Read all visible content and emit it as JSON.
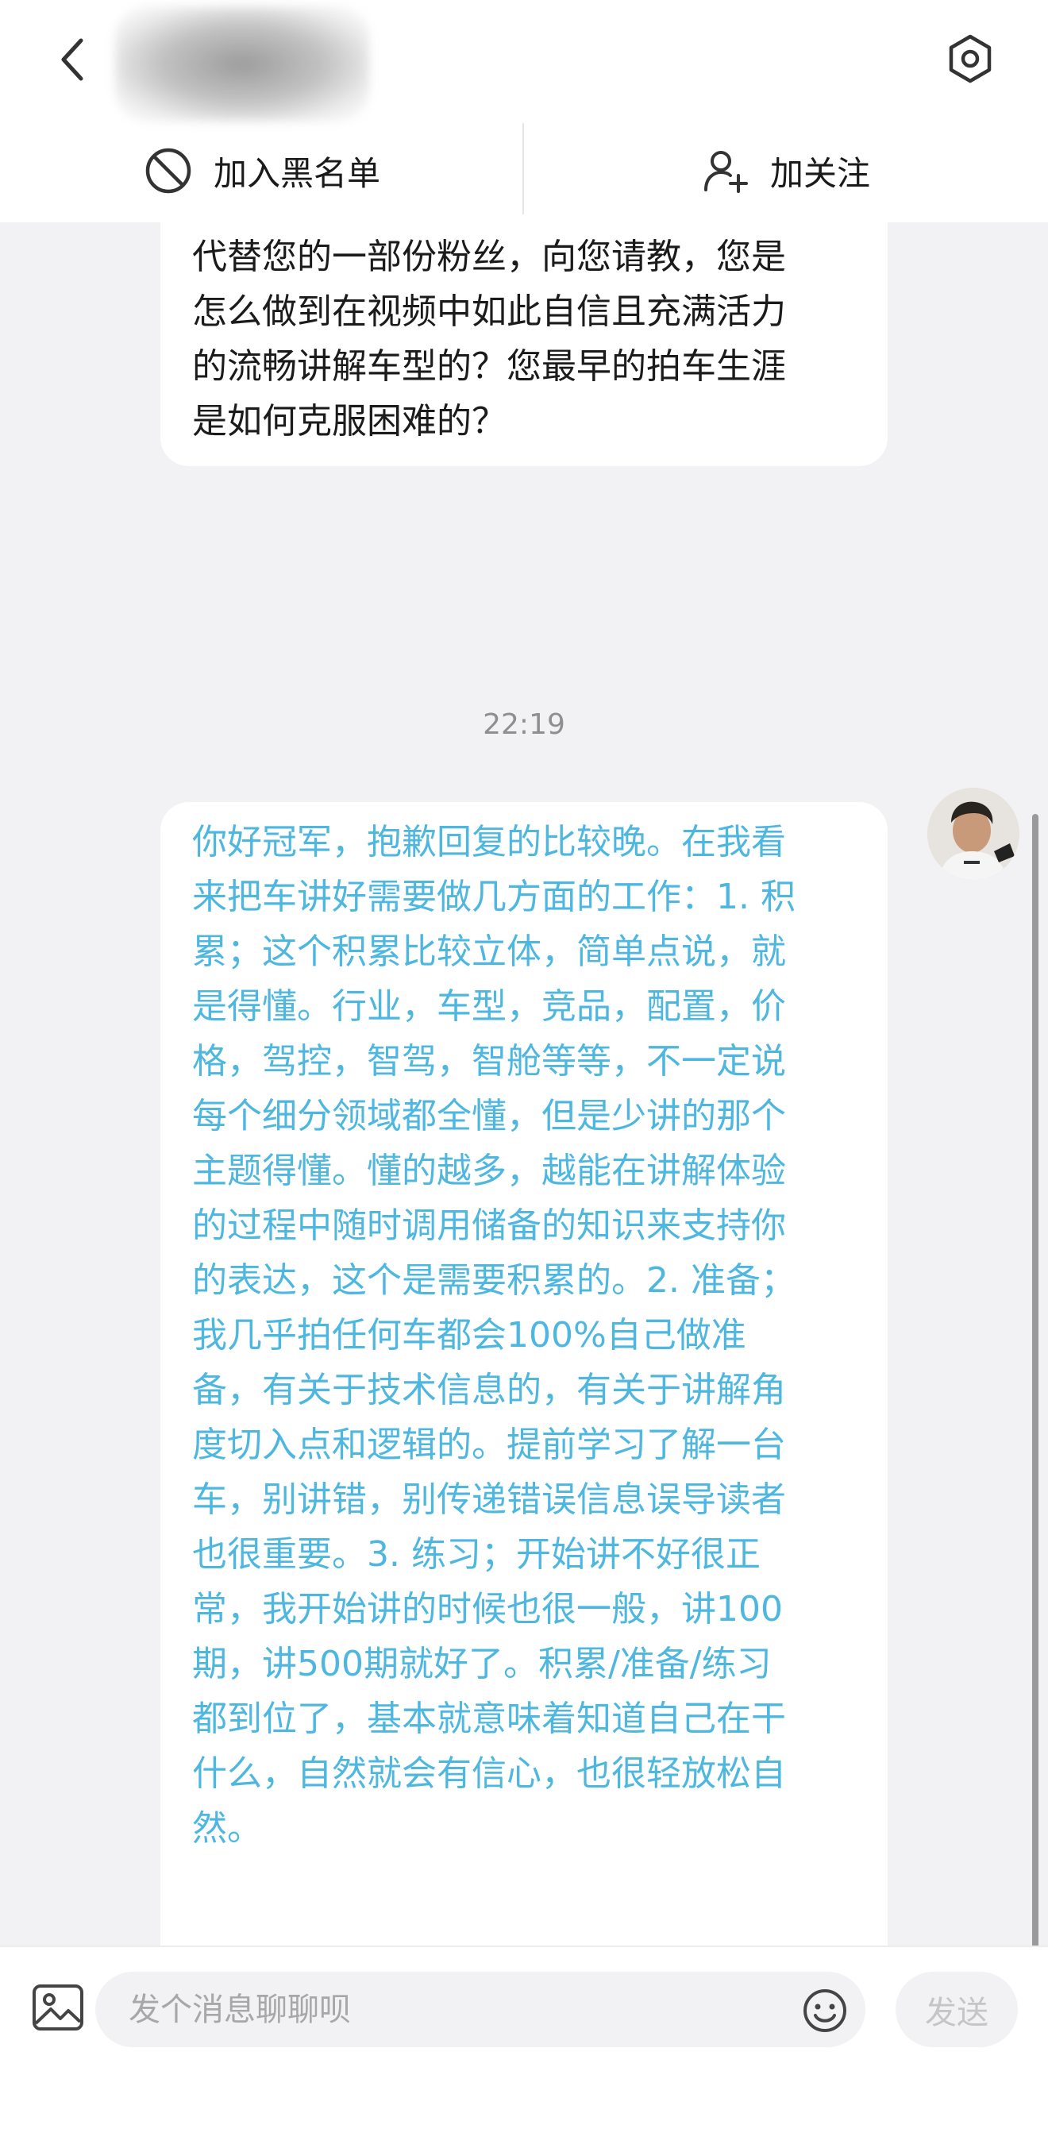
{
  "header": {
    "back_icon": "chevron-left-icon",
    "settings_icon": "hexagon-settings-icon",
    "actions": [
      {
        "label": "加入黑名单",
        "icon": "block-icon"
      },
      {
        "label": "加关注",
        "icon": "add-user-icon"
      }
    ]
  },
  "messages": [
    {
      "direction": "incoming",
      "text": "您家中的文化系不一样了。我相信也有\n很多冠军会因为您的视频爱上汽车，也\n梦想着有一天能像您一样，站在荧幕前\n向大家分享对车的感悟。我真诚的，也\n代替您的一部份粉丝，向您请教，您是\n怎么做到在视频中如此自信且充满活力\n的流畅讲解车型的？您最早的拍车生涯\n是如何克服困难的？"
    },
    {
      "type": "timestamp",
      "text": "22:19"
    },
    {
      "direction": "outgoing",
      "text": "你好冠军，抱歉回复的比较晚。在我看\n来把车讲好需要做几方面的工作：1. 积\n累；这个积累比较立体，简单点说，就\n是得懂。行业，车型，竞品，配置，价\n格，驾控，智驾，智舱等等，不一定说\n每个细分领域都全懂，但是少讲的那个\n主题得懂。懂的越多，越能在讲解体验\n的过程中随时调用储备的知识来支持你\n的表达，这个是需要积累的。2. 准备；\n我几乎拍任何车都会100%自己做准\n备，有关于技术信息的，有关于讲解角\n度切入点和逻辑的。提前学习了解一台\n车，别讲错，别传递错误信息误导读者\n也很重要。3. 练习；开始讲不好很正\n常，我开始讲的时候也很一般，讲100\n期，讲500期就好了。积累/准备/练习\n都到位了，基本就意味着知道自己在干\n什么，自然就会有信心，也很轻放松自\n然。",
      "text_color": "#4eb7e0"
    }
  ],
  "footer": {
    "image_icon": "image-icon",
    "input_placeholder": "发个消息聊聊呗",
    "emoji_icon": "smiley-icon",
    "send_label": "发送"
  }
}
